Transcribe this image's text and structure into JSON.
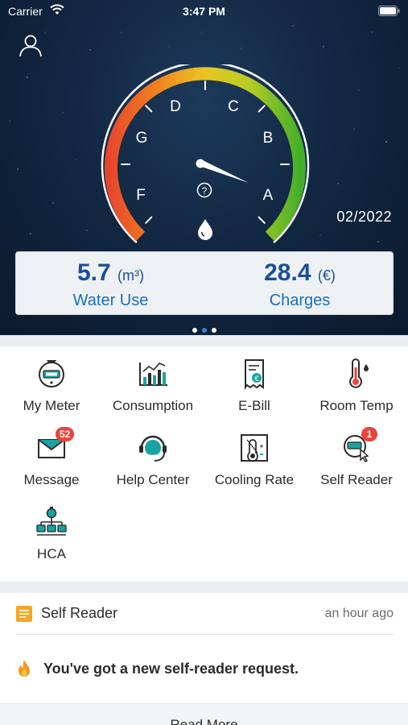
{
  "status_bar": {
    "carrier": "Carrier",
    "time": "3:47 PM"
  },
  "gauge": {
    "grades": [
      "G",
      "D",
      "C",
      "B",
      "F",
      "A"
    ],
    "help_symbol": "?",
    "current_grade": "A",
    "colors": {
      "red": "#e8452d",
      "orange": "#f39a1c",
      "yellow": "#e6d22a",
      "green": "#3fae2a"
    }
  },
  "period": "02/2022",
  "summary": {
    "water_use": {
      "value": "5.7",
      "unit": "(m³)",
      "label": "Water Use"
    },
    "charges": {
      "value": "28.4",
      "unit": "(€)",
      "label": "Charges"
    }
  },
  "pager": {
    "pages": 3,
    "active": 1
  },
  "menu": [
    {
      "label": "My Meter",
      "icon": "meter-icon"
    },
    {
      "label": "Consumption",
      "icon": "chart-icon"
    },
    {
      "label": "E-Bill",
      "icon": "bill-icon"
    },
    {
      "label": "Room Temp",
      "icon": "thermometer-icon"
    },
    {
      "label": "Message",
      "icon": "envelope-icon",
      "badge": "52"
    },
    {
      "label": "Help Center",
      "icon": "headset-icon"
    },
    {
      "label": "Cooling Rate",
      "icon": "cooling-icon"
    },
    {
      "label": "Self Reader",
      "icon": "self-reader-icon",
      "badge": "1"
    },
    {
      "label": "HCA",
      "icon": "hca-icon"
    }
  ],
  "notification": {
    "title": "Self Reader",
    "time": "an hour ago",
    "message": "You've got a new self-reader request.",
    "read_more": "Read More"
  },
  "colors": {
    "accent": "#1a4f9a",
    "teal": "#1aa3a3",
    "badge": "#e8453c"
  }
}
